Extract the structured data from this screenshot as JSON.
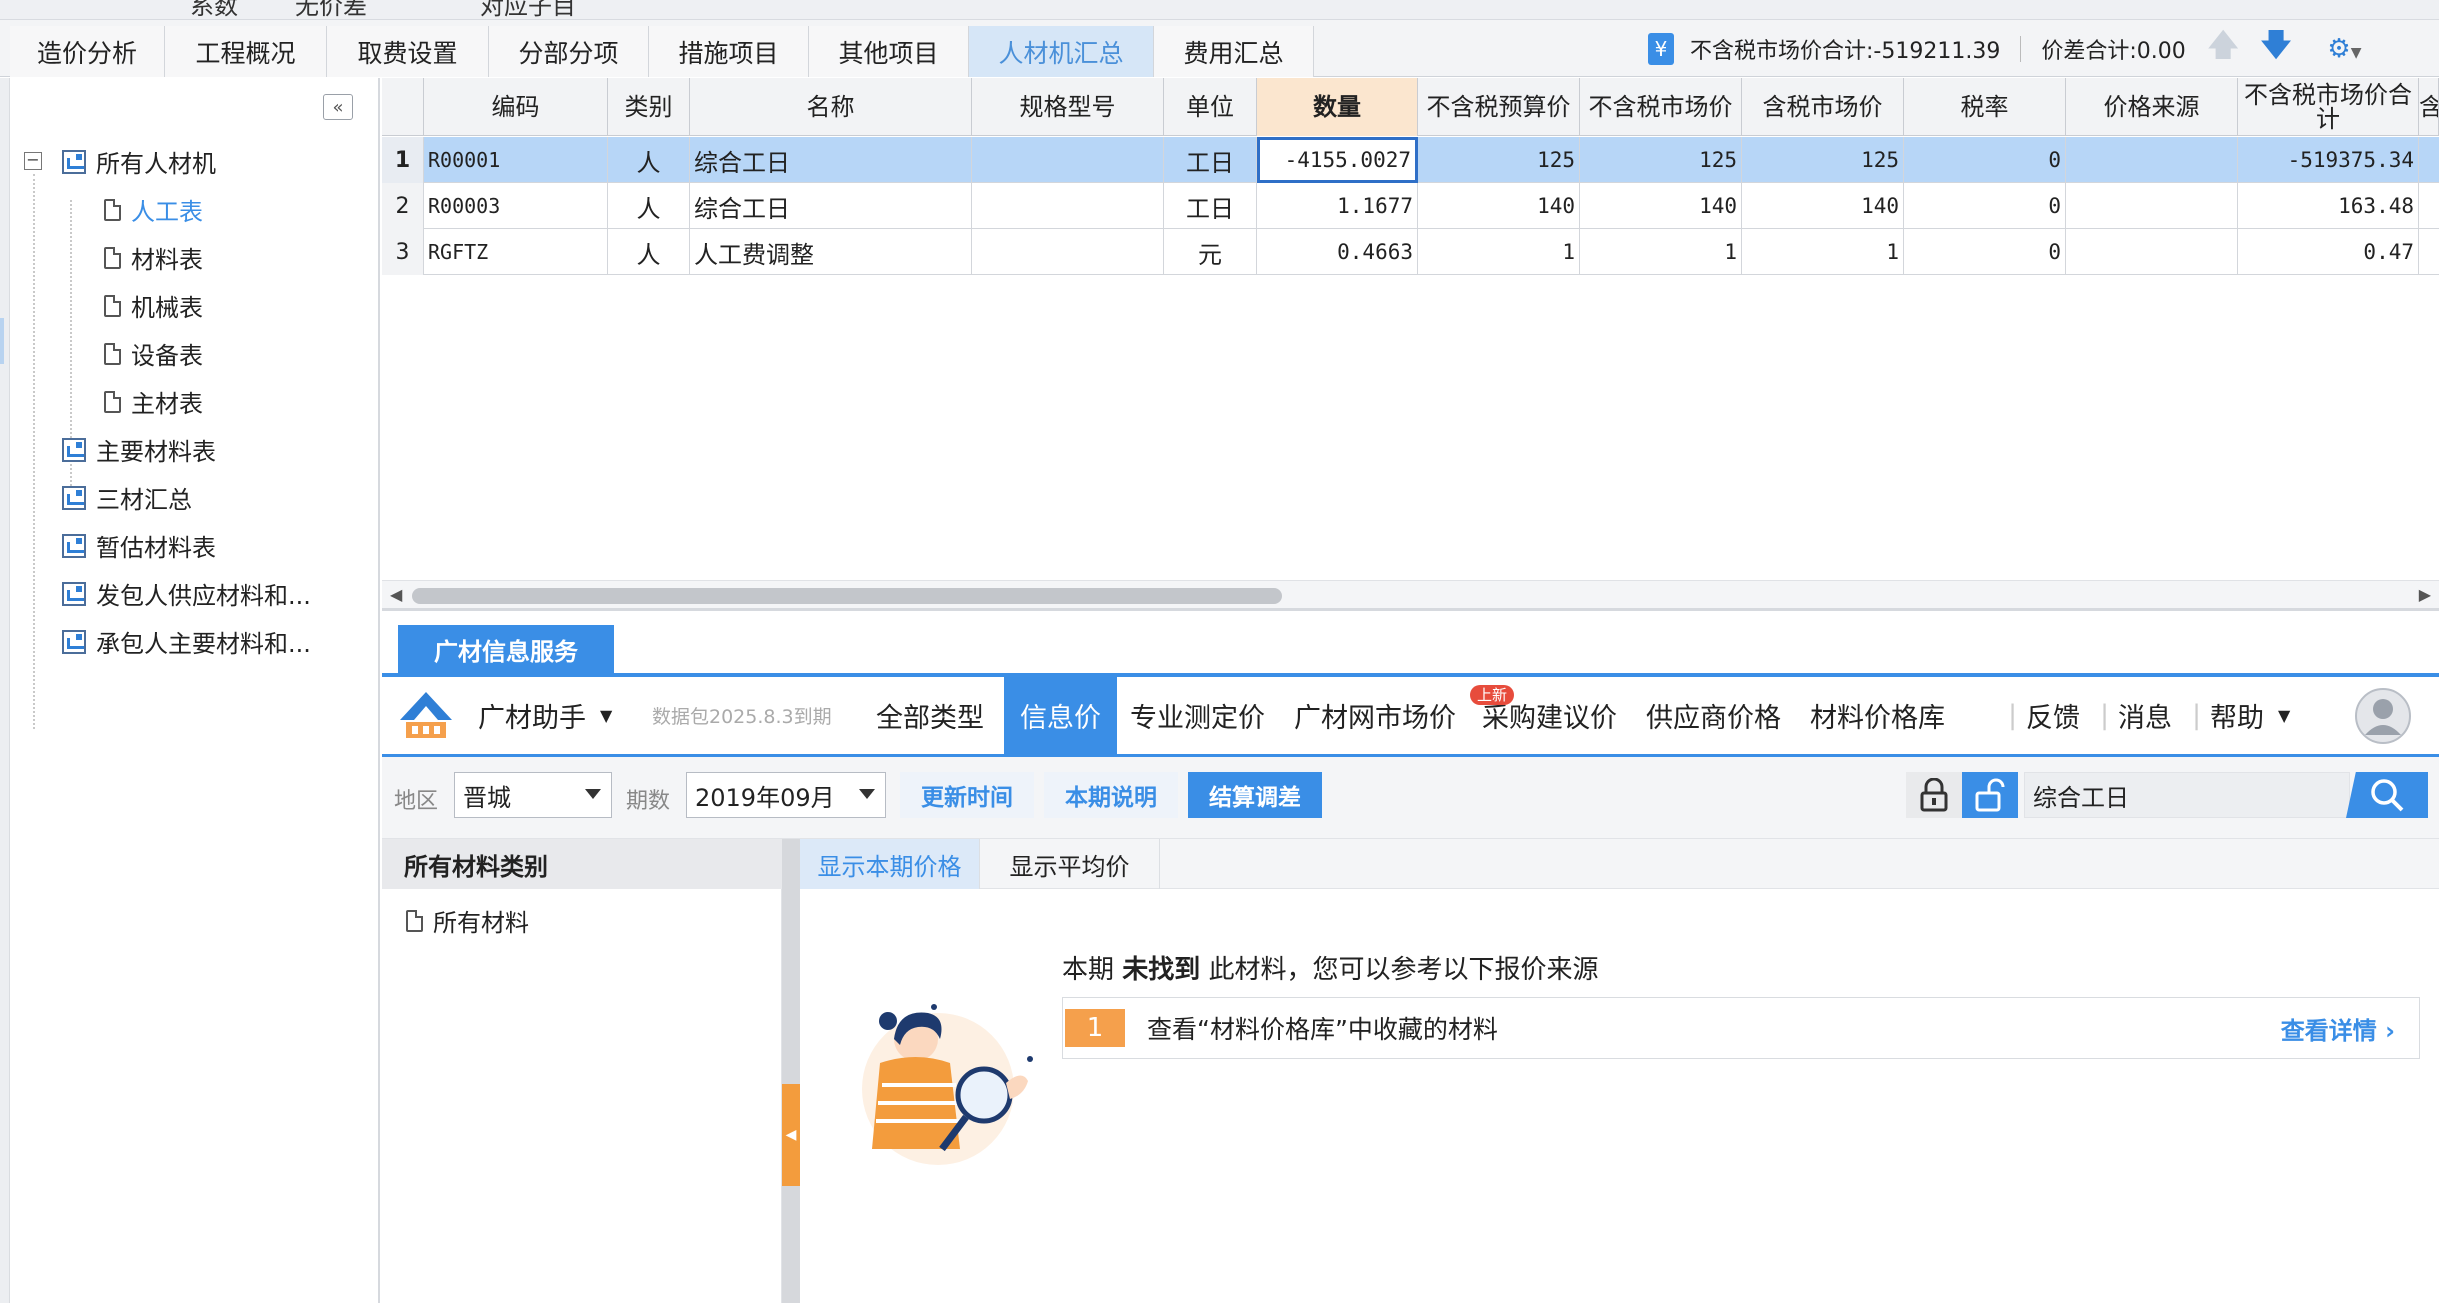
{
  "top_strip": [
    "系数",
    "无价差",
    "对应子目"
  ],
  "tabs": [
    "造价分析",
    "工程概况",
    "取费设置",
    "分部分项",
    "措施项目",
    "其他项目",
    "人材机汇总",
    "费用汇总"
  ],
  "active_tab": "人材机汇总",
  "summary": {
    "market_total": "不含税市场价合计:-519211.39",
    "diff_total": "价差合计:0.00"
  },
  "tree": {
    "root": "所有人材机",
    "children": [
      "人工表",
      "材料表",
      "机械表",
      "设备表",
      "主材表"
    ],
    "active_child": "人工表",
    "reports": [
      "主要材料表",
      "三材汇总",
      "暂估材料表",
      "发包人供应材料和...",
      "承包人主要材料和..."
    ]
  },
  "grid": {
    "columns": [
      "编码",
      "类别",
      "名称",
      "规格型号",
      "单位",
      "数量",
      "不含税预算价",
      "不含税市场价",
      "含税市场价",
      "税率",
      "价格来源",
      "不含税市场价合计",
      "含"
    ],
    "rows": [
      {
        "no": "1",
        "code": "R00001",
        "type": "人",
        "name": "综合工日",
        "spec": "",
        "unit": "工日",
        "qty": "-4155.0027",
        "budget": "125",
        "market": "125",
        "taxed": "125",
        "rate": "0",
        "source": "",
        "total": "-519375.34"
      },
      {
        "no": "2",
        "code": "R00003",
        "type": "人",
        "name": "综合工日",
        "spec": "",
        "unit": "工日",
        "qty": "1.1677",
        "budget": "140",
        "market": "140",
        "taxed": "140",
        "rate": "0",
        "source": "",
        "total": "163.48"
      },
      {
        "no": "3",
        "code": "RGFTZ",
        "type": "人",
        "name": "人工费调整",
        "spec": "",
        "unit": "元",
        "qty": "0.4663",
        "budget": "1",
        "market": "1",
        "taxed": "1",
        "rate": "0",
        "source": "",
        "total": "0.47"
      }
    ]
  },
  "service": {
    "tab": "广材信息服务",
    "assistant": "广材助手",
    "package_expiry": "数据包2025.8.3到期",
    "nav": [
      "全部类型",
      "信息价",
      "专业测定价",
      "广材网市场价",
      "采购建议价",
      "供应商价格",
      "材料价格库"
    ],
    "active_nav": "信息价",
    "new_badge": "上新",
    "right_nav": [
      "反馈",
      "消息",
      "帮助"
    ],
    "filter": {
      "region_label": "地区",
      "region": "晋城",
      "period_label": "期数",
      "period": "2019年09月",
      "btn_update": "更新时间",
      "btn_notes": "本期说明",
      "btn_settle": "结算调差",
      "search_value": "综合工日"
    },
    "category_header": "所有材料类别",
    "category_item": "所有材料",
    "price_tabs": [
      "显示本期价格",
      "显示平均价"
    ],
    "result": {
      "prefix": "本期 ",
      "bold": "未找到",
      "suffix": " 此材料，您可以参考以下报价来源",
      "row_num": "1",
      "row_text": "查看“材料价格库”中收藏的材料",
      "row_link": "查看详情"
    }
  },
  "colors": {
    "accent": "#3a8ee6",
    "orange": "#f5a04c",
    "active_tab_bg": "#d6e6f7",
    "qty_header_bg": "#fbe6cf",
    "selected_row": "#b7d6f7"
  }
}
